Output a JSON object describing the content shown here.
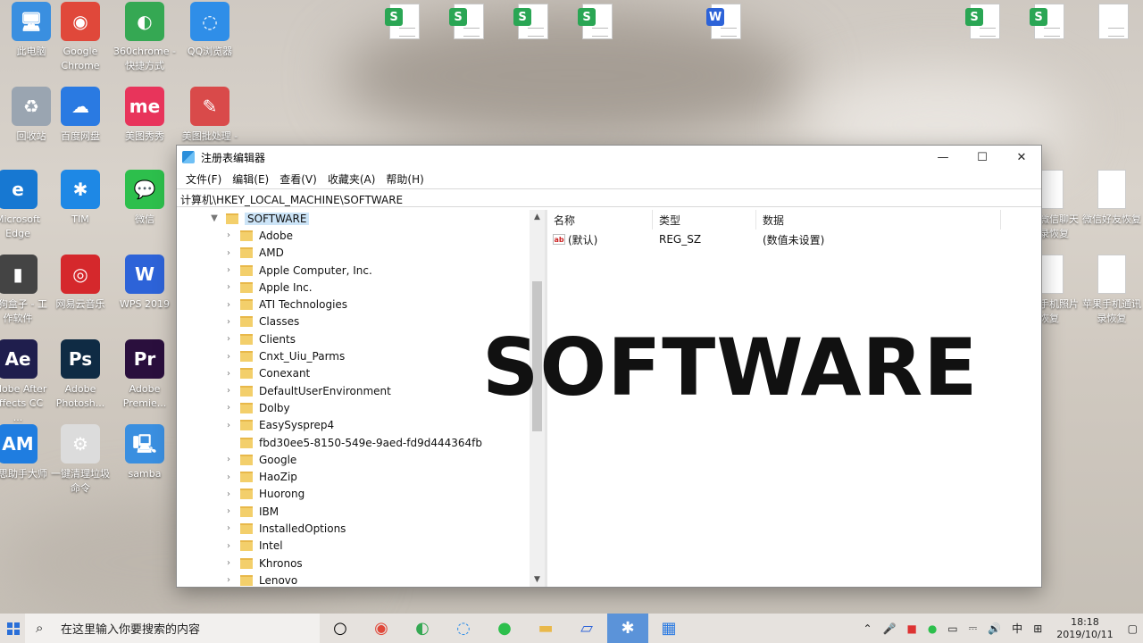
{
  "desktop": {
    "icons": [
      {
        "label": "此电脑",
        "glyph": "🖥",
        "color": "#3a8fe0"
      },
      {
        "label": "Google Chrome",
        "glyph": "◉",
        "color": "#e0483a"
      },
      {
        "label": "360chrome - 快捷方式",
        "glyph": "◐",
        "color": "#35a853"
      },
      {
        "label": "QQ浏览器",
        "glyph": "◌",
        "color": "#2f8ee8"
      },
      {
        "label": "回收站",
        "glyph": "♻",
        "color": "#9aa5b1"
      },
      {
        "label": "百度网盘",
        "glyph": "☁",
        "color": "#2a7ae2"
      },
      {
        "label": "美图秀秀",
        "glyph": "me",
        "color": "#e8345b"
      },
      {
        "label": "美图批处理 -",
        "glyph": "✎",
        "color": "#d94a4a"
      },
      {
        "label": "Microsoft Edge",
        "glyph": "e",
        "color": "#1778d2"
      },
      {
        "label": "TIM",
        "glyph": "✱",
        "color": "#1e88e5"
      },
      {
        "label": "微信",
        "glyph": "💬",
        "color": "#2dbf4c"
      },
      {
        "label": "酷狗盒子 - 工作软件",
        "glyph": "▮",
        "color": "#444"
      },
      {
        "label": "网易云音乐",
        "glyph": "◎",
        "color": "#d5282c"
      },
      {
        "label": "WPS 2019",
        "glyph": "W",
        "color": "#2d63d8"
      },
      {
        "label": "Adobe After Effects CC ...",
        "glyph": "Ae",
        "color": "#1f1e4d"
      },
      {
        "label": "Adobe Photosh...",
        "glyph": "Ps",
        "color": "#0f2b44"
      },
      {
        "label": "Adobe Premie...",
        "glyph": "Pr",
        "color": "#2a0f3d"
      },
      {
        "label": "爱思助手大师",
        "glyph": "AM",
        "color": "#1f7de0"
      },
      {
        "label": "一键清理垃圾命令",
        "glyph": "⚙",
        "color": "#dcdcdc"
      },
      {
        "label": "samba",
        "glyph": "🖳",
        "color": "#3a8fe0"
      },
      {
        "label": "手机微信聊天记录恢复",
        "glyph": "",
        "color": "#ffffff"
      },
      {
        "label": "微信好友恢复",
        "glyph": "",
        "color": "#ffffff"
      },
      {
        "label": "安卓手机照片恢复",
        "glyph": "",
        "color": "#ffffff"
      },
      {
        "label": "苹果手机通讯录恢复",
        "glyph": "",
        "color": "#ffffff"
      }
    ]
  },
  "window": {
    "title": "注册表编辑器",
    "controls": {
      "minimize": "—",
      "maximize": "☐",
      "close": "✕"
    },
    "menu": [
      "文件(F)",
      "编辑(E)",
      "查看(V)",
      "收藏夹(A)",
      "帮助(H)"
    ],
    "address": "计算机\\HKEY_LOCAL_MACHINE\\SOFTWARE",
    "tree": {
      "root": "SOFTWARE",
      "items": [
        "Adobe",
        "AMD",
        "Apple Computer, Inc.",
        "Apple Inc.",
        "ATI Technologies",
        "Classes",
        "Clients",
        "Cnxt_Uiu_Parms",
        "Conexant",
        "DefaultUserEnvironment",
        "Dolby",
        "EasySysprep4",
        "fbd30ee5-8150-549e-9aed-fd9d444364fb",
        "Google",
        "HaoZip",
        "Huorong",
        "IBM",
        "InstalledOptions",
        "Intel",
        "Khronos",
        "Lenovo"
      ]
    },
    "list": {
      "columns": [
        "名称",
        "类型",
        "数据"
      ],
      "rows": [
        {
          "name": "(默认)",
          "type": "REG_SZ",
          "data": "(数值未设置)"
        }
      ]
    },
    "overlay_text": "SOFTWARE"
  },
  "taskbar": {
    "search_placeholder": "在这里输入你要搜索的内容",
    "ime": "中",
    "time": "18:18",
    "date": "2019/10/11"
  }
}
